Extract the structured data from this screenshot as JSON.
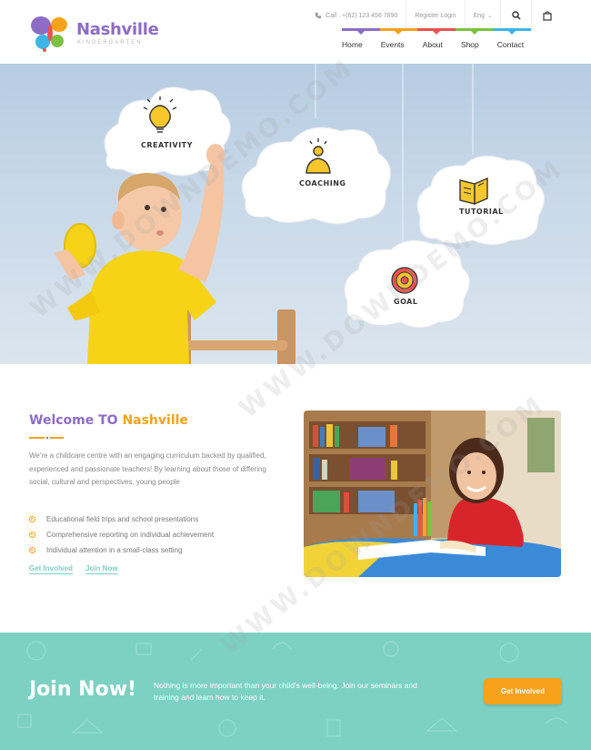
{
  "header": {
    "logo_name": "Nashville",
    "logo_tag": "KINDERGARTEN",
    "call": "Call : +(62) 123 456 7890",
    "register": "Register Login",
    "lang": "Eng",
    "nav": [
      "Home",
      "Events",
      "About",
      "Shop",
      "Contact"
    ]
  },
  "hero": {
    "clouds": [
      "CREATIVITY",
      "COACHING",
      "TUTORIAL",
      "GOAL"
    ]
  },
  "welcome": {
    "title_main": "Welcome TO ",
    "title_accent": "Nashville",
    "text": "We're a childcare centre with an engaging curriculum backed by qualified, experienced and passionate teachers! By learning about those of differing social, cultural and perspectives, young people",
    "list": [
      "Educational field trips and school presentations",
      "Comprehensive reporting on individual achievement",
      "Individual attention in a small-class setting"
    ],
    "link_involved": "Get Involved",
    "link_join": "Join Now"
  },
  "join": {
    "title": "Join Now!",
    "text": "Nothing is more important than your child's well-being. Join our seminars and training and learn how to keep it.",
    "button": "Get Involved"
  },
  "watermark": "WWW.DOWNDEMO.COM",
  "colors": {
    "purple": "#8d6cc7",
    "orange": "#f4a31b",
    "teal": "#7cd1c3",
    "nav_rainbow": [
      "#8d6cc7",
      "#f4a31b",
      "#e9534e",
      "#7cc242",
      "#3fb4e6"
    ]
  }
}
